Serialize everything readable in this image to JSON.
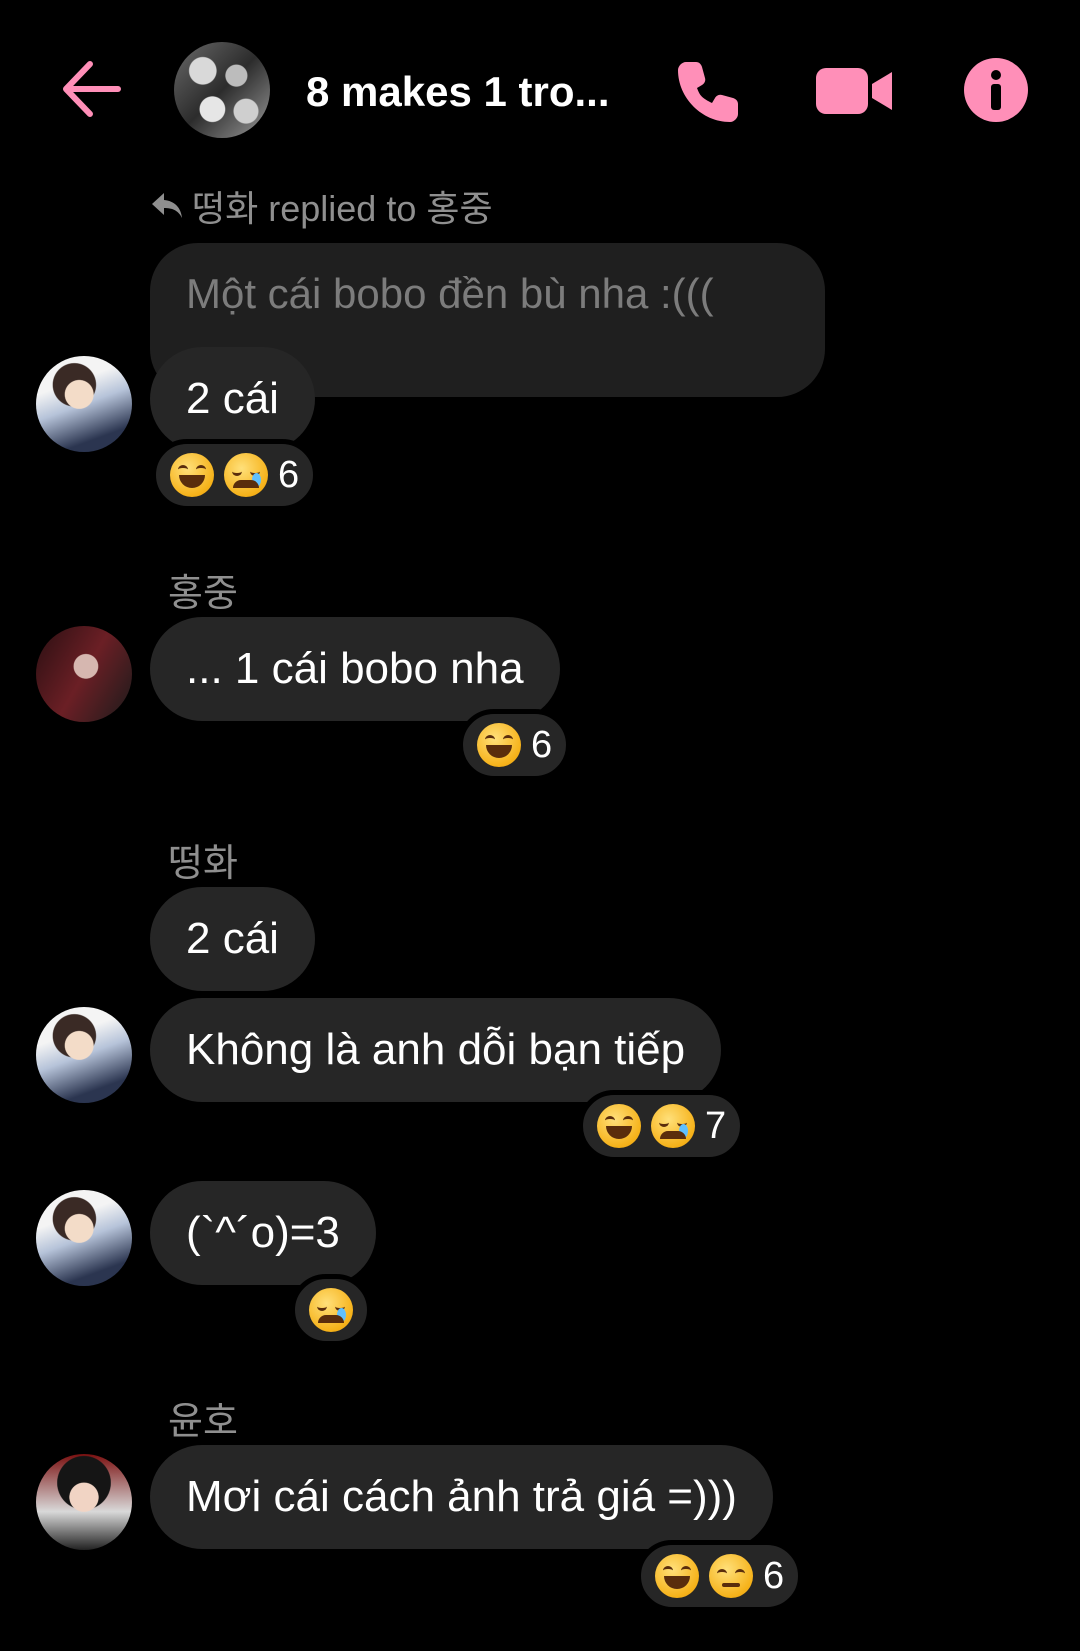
{
  "header": {
    "title": "8 makes 1 tro...",
    "accent": "#ff8fb8",
    "icons": [
      "back-arrow-icon",
      "phone-icon",
      "video-camera-icon",
      "info-icon"
    ]
  },
  "reply": {
    "indicator": "떵화 replied to 홍중",
    "quoted": "Một cái bobo đền bù nha :((("
  },
  "messages": {
    "m1": {
      "text": "2 cái",
      "reaction_count": "6"
    },
    "sender2": "홍중",
    "m2": {
      "text": "... 1 cái bobo nha",
      "reaction_count": "6"
    },
    "sender3": "떵화",
    "m3": {
      "text": "2 cái"
    },
    "m4": {
      "text": "Không là anh dỗi bạn tiếp",
      "reaction_count": "7"
    },
    "m5": {
      "text": "(`^´o)=3"
    },
    "sender6": "윤호",
    "m6": {
      "text": "Mơi cái cách ảnh trả giá =)))",
      "reaction_count": "6"
    }
  },
  "colors": {
    "background": "#000000",
    "bubble": "#262626",
    "accent": "#ff8fb8"
  }
}
